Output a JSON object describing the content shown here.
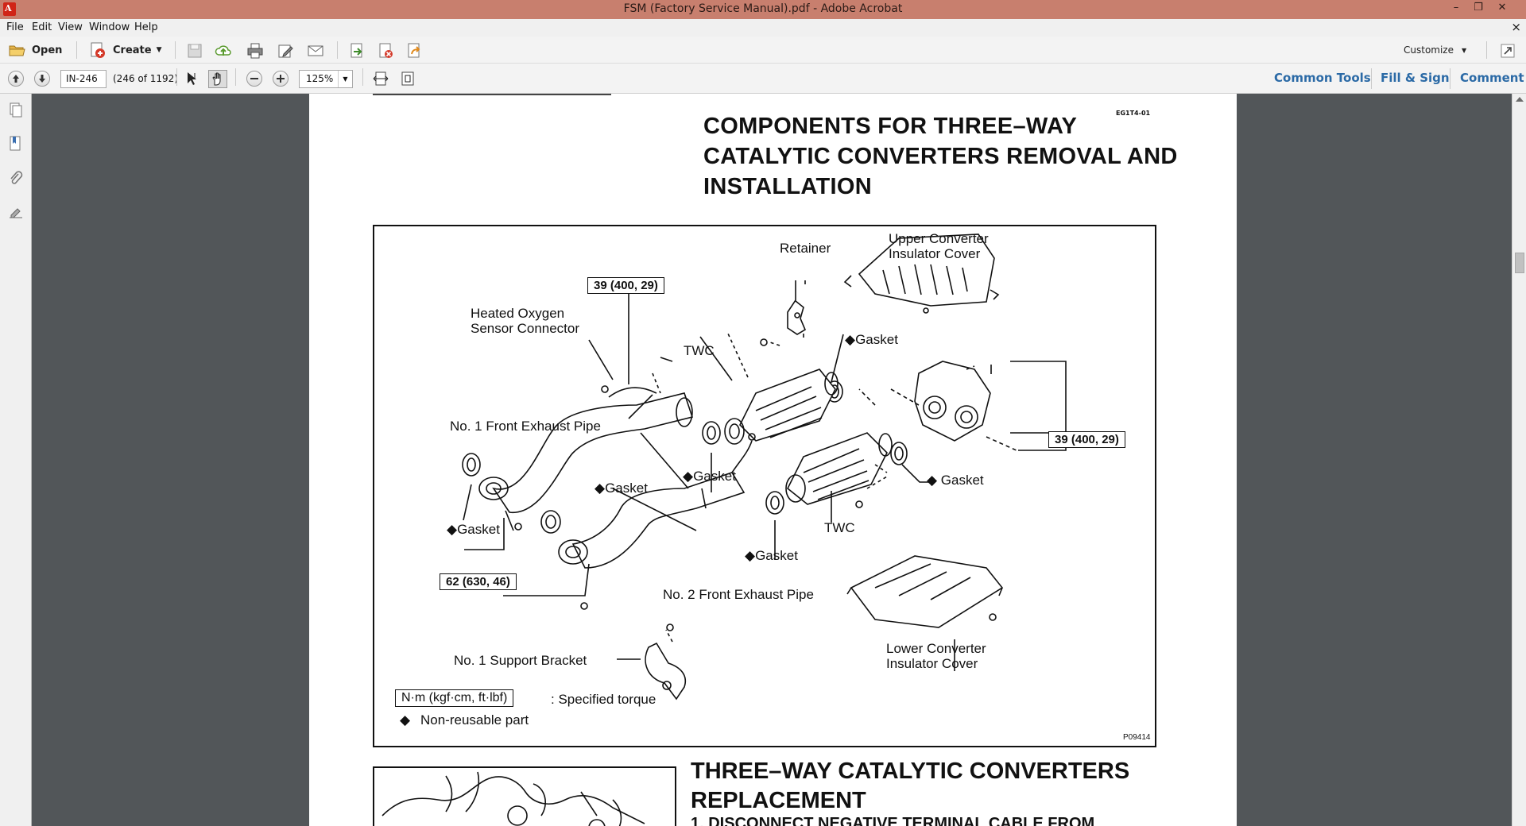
{
  "window": {
    "title": "FSM (Factory Service Manual).pdf - Adobe Acrobat",
    "app_icon_glyph": "A",
    "controls": {
      "minimize": "–",
      "restore": "❐",
      "close": "✕"
    }
  },
  "menu": {
    "items": [
      "File",
      "Edit",
      "View",
      "Window",
      "Help"
    ],
    "doc_close": "×"
  },
  "toolbar": {
    "open_label": "Open",
    "create_label": "Create",
    "customize_label": "Customize"
  },
  "navigation": {
    "page_field": "IN-246",
    "page_count": "(246 of 1192)",
    "zoom": "125%"
  },
  "tool_tabs": [
    "Common Tools",
    "Fill & Sign",
    "Comment"
  ],
  "document": {
    "page_code": "EG1T4-01",
    "heading_lines": [
      "COMPONENTS FOR THREE–WAY",
      "CATALYTIC CONVERTERS REMOVAL AND",
      "INSTALLATION"
    ],
    "figure": {
      "labels": {
        "upper_cover_1": "Upper Converter",
        "upper_cover_2": "Insulator Cover",
        "retainer": "Retainer",
        "torque_39_top": "39 (400, 29)",
        "o2_sensor_1": "Heated Oxygen",
        "o2_sensor_2": "Sensor Connector",
        "twc_top": "TWC",
        "gasket_top": "◆Gasket",
        "torque_39_right": "39 (400, 29)",
        "no1_pipe": "No. 1 Front Exhaust Pipe",
        "gasket_mid": "◆Gasket",
        "gasket_left_center": "◆Gasket",
        "gasket_right": "◆ Gasket",
        "gasket_left": "◆Gasket",
        "twc_bottom": "TWC",
        "gasket_bottom": "◆Gasket",
        "torque_62": "62 (630, 46)",
        "no2_pipe": "No. 2 Front Exhaust Pipe",
        "lower_cover_1": "Lower Converter",
        "lower_cover_2": "Insulator Cover",
        "support_bracket": "No. 1 Support Bracket",
        "legend_unit": "N·m (kgf·cm, ft·lbf)",
        "legend_unit_desc": ":  Specified torque",
        "legend_diamond": "◆",
        "legend_diamond_desc": "Non-reusable part",
        "figure_code": "P09414"
      }
    },
    "heading2_lines": [
      "THREE–WAY CATALYTIC CONVERTERS",
      "REPLACEMENT"
    ],
    "step1": "1. DISCONNECT NEGATIVE TERMINAL CABLE FROM"
  }
}
